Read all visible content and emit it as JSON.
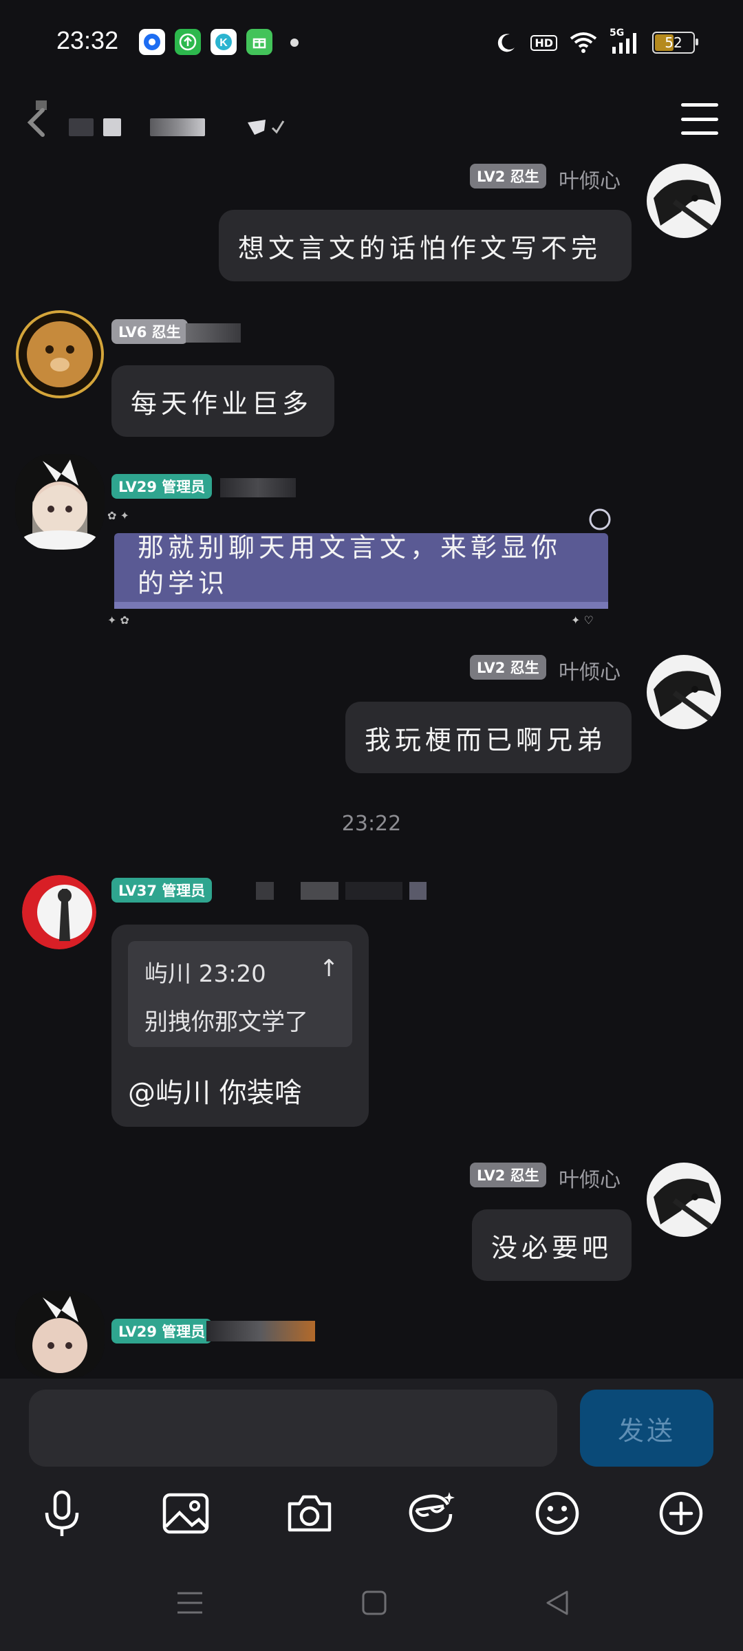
{
  "status_bar": {
    "time": "23:32",
    "apps": [
      {
        "icon": "app-blue-icon",
        "color": "#ffffff"
      },
      {
        "icon": "app-green-upload-icon",
        "color": "#2db84d"
      },
      {
        "icon": "app-k-icon",
        "color": "#ffffff"
      },
      {
        "icon": "app-green-gift-icon",
        "color": "#43c35a"
      }
    ],
    "hd": "HD",
    "network": "5G",
    "battery": "52",
    "battery_level": 0.52
  },
  "header": {
    "back_icon": "chevron-left-icon",
    "menu_icon": "hamburger-menu-icon"
  },
  "messages": [
    {
      "side": "right",
      "level": "LV2 忍生",
      "nick": "叶倾心",
      "text": "想文言文的话怕作文写不完"
    },
    {
      "side": "left",
      "level": "LV6 忍生",
      "text": "每天作业巨多"
    },
    {
      "side": "left",
      "level": "LV29 管理员",
      "text_line1": "那就别聊天用文言文，来彰显你",
      "text_line2": "的学识"
    },
    {
      "side": "right",
      "level": "LV2 忍生",
      "nick": "叶倾心",
      "text": "我玩梗而已啊兄弟"
    },
    {
      "time_separator": "23:22"
    },
    {
      "side": "left",
      "level": "LV37 管理员",
      "quote_header": "屿川 23:20",
      "quote_jump": "↑",
      "quote_text": "别拽你那文学了",
      "text": "@屿川 你装啥"
    },
    {
      "side": "right",
      "level": "LV2 忍生",
      "nick": "叶倾心",
      "text": "没必要吧"
    },
    {
      "side": "left",
      "level": "LV29 管理员"
    }
  ],
  "input": {
    "placeholder": "",
    "send_label": "发送"
  },
  "toolbar": [
    "microphone-icon",
    "image-icon",
    "camera-icon",
    "sticker-icon",
    "emoji-icon",
    "plus-icon"
  ],
  "nav_bar": [
    "menu-nav-icon",
    "home-nav-icon",
    "back-nav-icon"
  ]
}
